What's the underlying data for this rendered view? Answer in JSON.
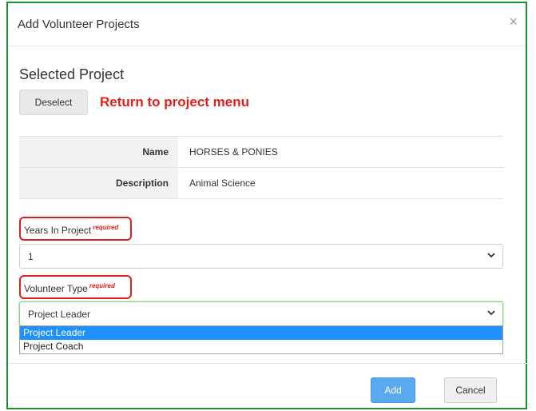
{
  "modal": {
    "title": "Add Volunteer Projects",
    "close_glyph": "×",
    "close_icon": "close-icon"
  },
  "selected_project": {
    "heading": "Selected Project",
    "deselect_label": "Deselect",
    "annotation": "Return to project menu",
    "rows": [
      {
        "label": "Name",
        "value": "HORSES & PONIES"
      },
      {
        "label": "Description",
        "value": "Animal Science"
      }
    ]
  },
  "fields": {
    "years": {
      "label": "Years In Project",
      "required_label": "required",
      "value": "1"
    },
    "volunteer_type": {
      "label": "Volunteer Type",
      "required_label": "required",
      "value": "Project Leader",
      "options": [
        "Project Leader",
        "Project Coach"
      ],
      "selected_option": "Project Leader"
    }
  },
  "footer": {
    "add_label": "Add",
    "cancel_label": "Cancel"
  },
  "colors": {
    "frame_border": "#1f8f2f",
    "annotation_red": "#e02020",
    "primary_button": "#5aa8f0",
    "dropdown_highlight": "#1e90ff"
  }
}
